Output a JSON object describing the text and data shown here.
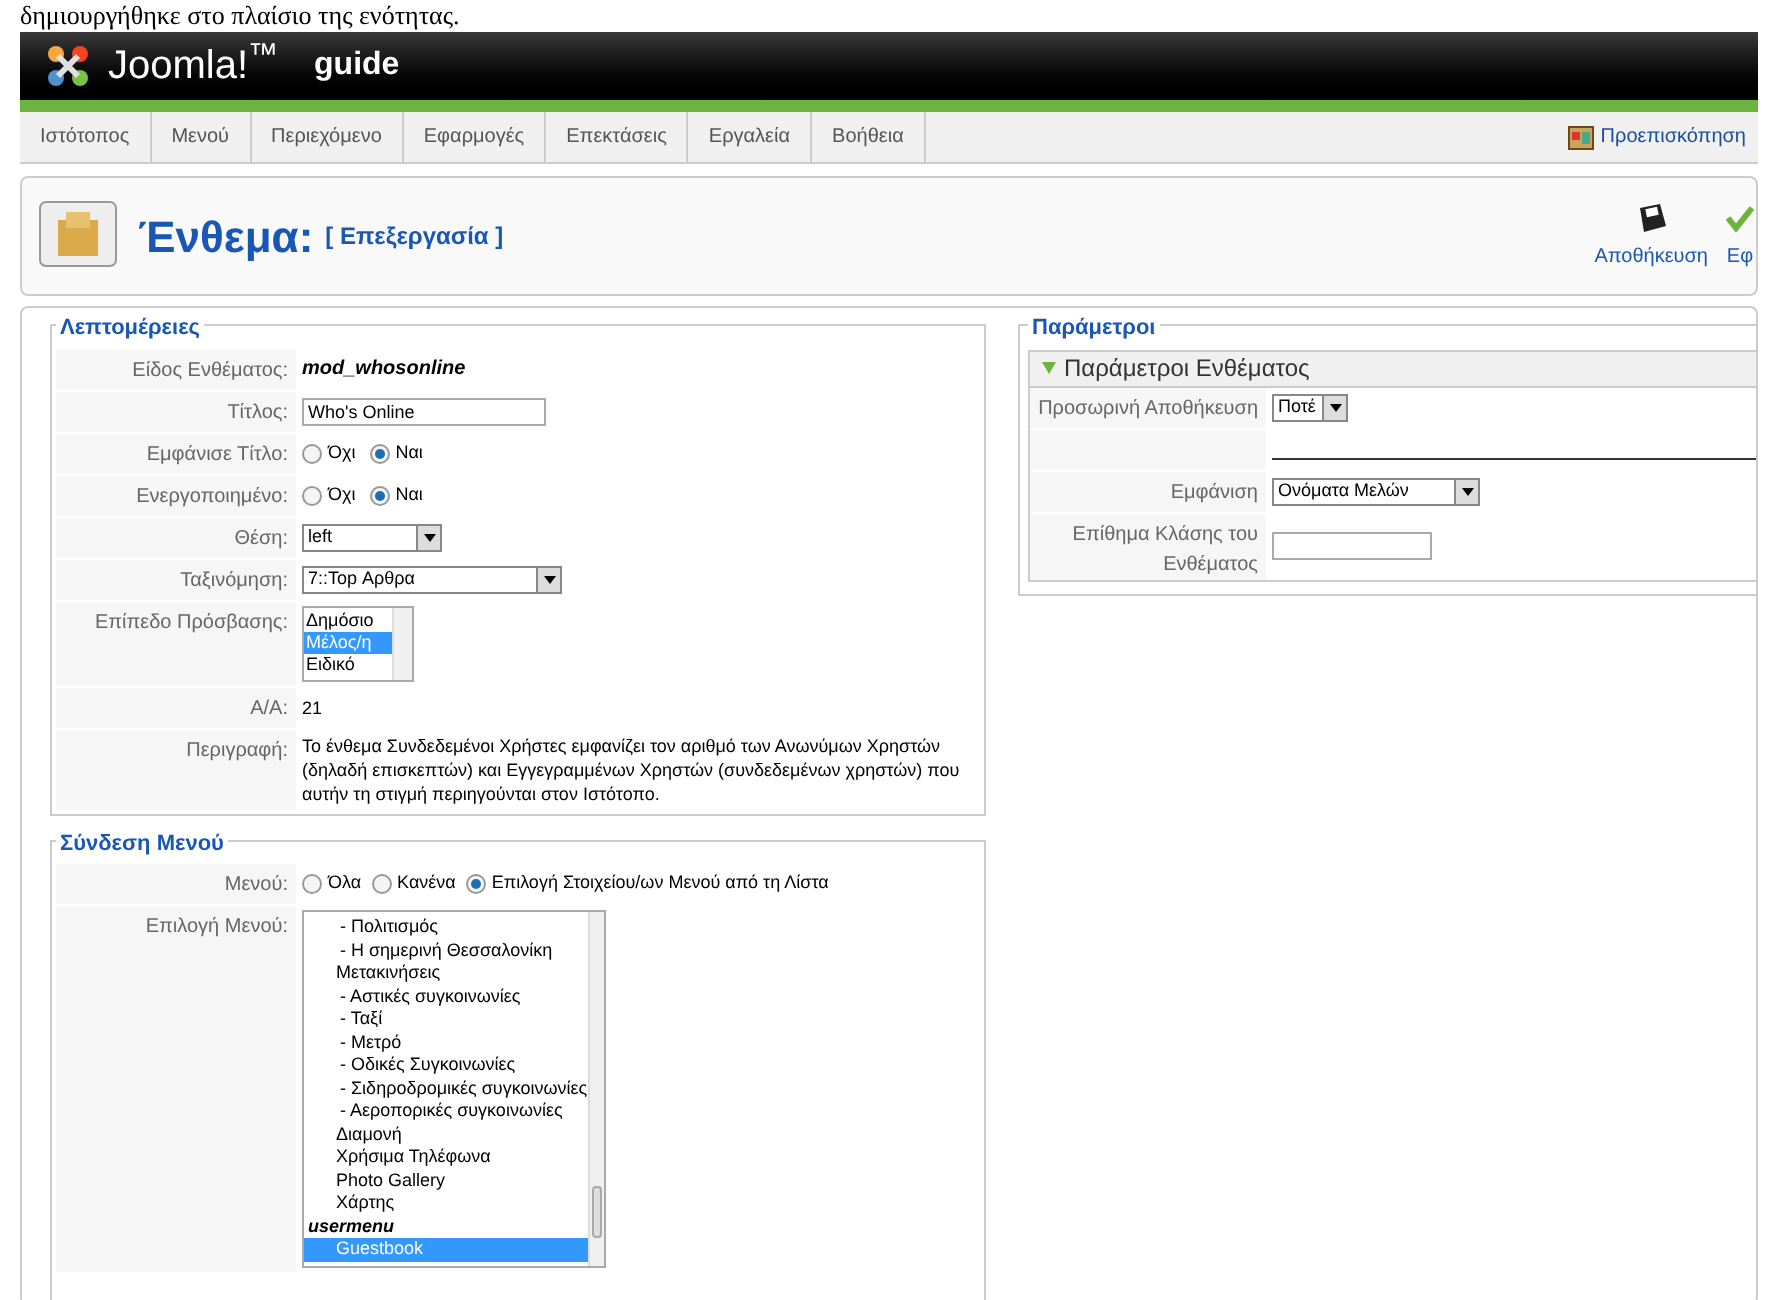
{
  "caption": "δημιουργήθηκε στο πλαίσιο της ενότητας.",
  "header": {
    "brand": "Joomla!$^{™}$",
    "site": "guide"
  },
  "menu": [
    {
      "label": "Ιστότοπος"
    },
    {
      "label": "Μενού"
    },
    {
      "label": "Περιεχόμενο"
    },
    {
      "label": "Εφαρμογές"
    },
    {
      "label": "Επεκτάσεις"
    },
    {
      "label": "Εργαλεία"
    },
    {
      "label": "Βοήθεια"
    }
  ],
  "preview": "Προεπισκόπηση",
  "page_title": {
    "title": "Ένθεμα:",
    "subtitle": "[ Επεξεργασία ]"
  },
  "toolbar": [
    {
      "kind": "save",
      "label": "Αποθήκευση"
    },
    {
      "kind": "apply",
      "label": "Εφ"
    }
  ],
  "details": {
    "legend": "Λεπτομέρειες",
    "rows": [
      {
        "kind": "static",
        "label": "Είδος Ενθέματος:",
        "value": "mod_whosonline"
      },
      {
        "kind": "text",
        "label": "Τίτλος:",
        "value": "Who's Online"
      },
      {
        "kind": "radio",
        "label": "Εμφάνισε Τίτλο:",
        "options": [
          {
            "label": "Όχι",
            "selected": false
          },
          {
            "label": "Ναι",
            "selected": true
          }
        ]
      },
      {
        "kind": "radio",
        "label": "Ενεργοποιημένο:",
        "options": [
          {
            "label": "Όχι",
            "selected": false
          },
          {
            "label": "Ναι",
            "selected": true
          }
        ]
      },
      {
        "kind": "select",
        "label": "Θέση:",
        "value": "left"
      },
      {
        "kind": "select",
        "label": "Ταξινόμηση:",
        "value": "7::Top Αρθρα"
      },
      {
        "kind": "list",
        "label": "Επίπεδο Πρόσβασης:",
        "options": [
          {
            "label": "Δημόσιο",
            "selected": false
          },
          {
            "label": "Μέλος/η",
            "selected": true
          },
          {
            "label": "Ειδικό",
            "selected": false
          }
        ]
      },
      {
        "kind": "plain",
        "label": "Α/Α:",
        "value": "21"
      },
      {
        "kind": "plain",
        "label": "Περιγραφή:",
        "value": "Το ένθεμα Συνδεδεμένοι Χρήστες εμφανίζει τον αριθμό των Ανωνύμων Χρηστών (δηλαδή επισκεπτών) και Εγγεγραμμένων Χρηστών (συνδεδεμένων χρηστών) που αυτήν τη στιγμή περιηγούνται στον Ιστότοπο."
      }
    ]
  },
  "menu_link": {
    "legend": "Σύνδεση Μενού",
    "menus_label": "Μενού:",
    "menus": [
      {
        "label": "Όλα",
        "selected": false
      },
      {
        "label": "Κανένα",
        "selected": false
      },
      {
        "label": "Επιλογή Στοιχείου/ων Μενού από τη Λίστα",
        "selected": true
      }
    ],
    "select_label": "Επιλογή Μενού:",
    "items": [
      {
        "kind": "sub",
        "text": "- Πολιτισμός",
        "selected": false
      },
      {
        "kind": "sub",
        "text": "- Η σημερινή Θεσσαλονίκη",
        "selected": false
      },
      {
        "kind": "item",
        "text": "Μετακινήσεις",
        "selected": false
      },
      {
        "kind": "sub",
        "text": "- Αστικές συγκοινωνίες",
        "selected": false
      },
      {
        "kind": "sub",
        "text": "- Ταξί",
        "selected": false
      },
      {
        "kind": "sub",
        "text": "- Μετρό",
        "selected": false
      },
      {
        "kind": "sub",
        "text": "- Οδικές Συγκοινωνίες",
        "selected": false
      },
      {
        "kind": "sub",
        "text": "- Σιδηροδρομικές συγκοινωνίες",
        "selected": false
      },
      {
        "kind": "sub",
        "text": "- Αεροπορικές συγκοινωνίες",
        "selected": false
      },
      {
        "kind": "item",
        "text": "Διαμονή",
        "selected": false
      },
      {
        "kind": "item",
        "text": "Χρήσιμα Τηλέφωνα",
        "selected": false
      },
      {
        "kind": "item",
        "text": "Photo Gallery",
        "selected": false
      },
      {
        "kind": "item",
        "text": "Χάρτης",
        "selected": false
      },
      {
        "kind": "menu",
        "text": "usermenu",
        "selected": false
      },
      {
        "kind": "item",
        "text": "Guestbook",
        "selected": true
      }
    ]
  },
  "parameters": {
    "legend": "Παράμετροι",
    "panel_title": "Παράμετροι Ενθέματος",
    "expanded": true,
    "rows": [
      {
        "kind": "select",
        "label": "Προσωρινή Αποθήκευση",
        "value": "Ποτέ"
      },
      {
        "kind": "rule"
      },
      {
        "kind": "select",
        "label": "Εμφάνιση",
        "value": "Ονόματα Μελών"
      },
      {
        "kind": "text",
        "label": "Επίθημα Κλάσης του Ενθέματος",
        "value": ""
      }
    ]
  }
}
